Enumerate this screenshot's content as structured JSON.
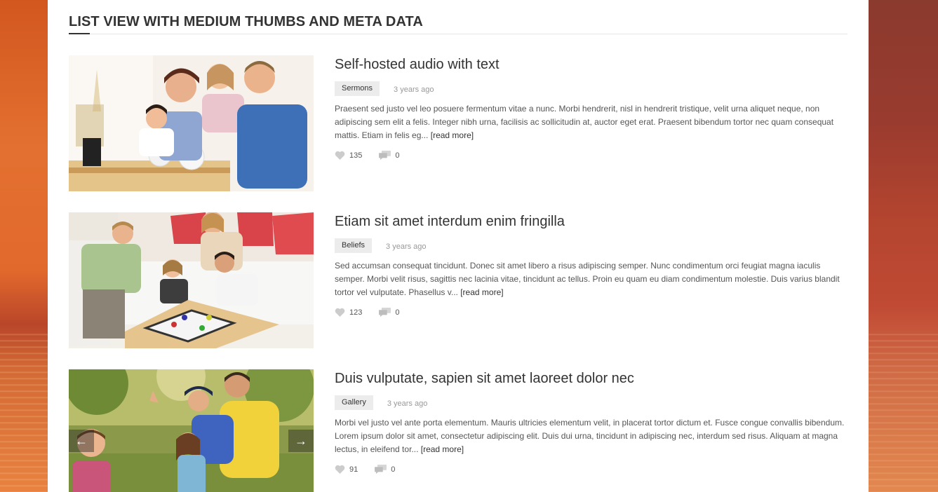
{
  "section": {
    "title": "LIST VIEW WITH MEDIUM THUMBS AND META DATA"
  },
  "posts": [
    {
      "title": "Self-hosted audio with text",
      "category": "Sermons",
      "date": "3 years ago",
      "excerpt": "Praesent sed justo vel leo posuere fermentum vitae a nunc. Morbi hendrerit, nisl in hendrerit tristique, velit urna aliquet neque, non adipiscing sem elit a felis. Integer nibh urna, facilisis ac sollicitudin at, auctor eget erat. Praesent bibendum tortor nec quam consequat mattis. Etiam in felis eg...",
      "read_more": "[read more]",
      "likes": "135",
      "comments": "0"
    },
    {
      "title": "Etiam sit amet interdum enim fringilla",
      "category": "Beliefs",
      "date": "3 years ago",
      "excerpt": "Sed accumsan consequat tincidunt. Donec sit amet libero a risus adipiscing semper. Nunc condimentum orci feugiat magna iaculis semper. Morbi velit risus, sagittis nec lacinia vitae, tincidunt ac tellus. Proin eu quam eu diam condimentum molestie. Duis varius blandit tortor vel vulputate. Phasellus v...",
      "read_more": "[read more]",
      "likes": "123",
      "comments": "0"
    },
    {
      "title": "Duis vulputate, sapien sit amet laoreet dolor nec",
      "category": "Gallery",
      "date": "3 years ago",
      "excerpt": "Morbi vel justo vel ante porta elementum. Mauris ultricies elementum velit, in placerat tortor dictum et. Fusce congue convallis bibendum. Lorem ipsum dolor sit amet, consectetur adipiscing elit. Duis dui urna, tincidunt in adipiscing nec, interdum sed risus. Aliquam at magna lectus, in eleifend tor...",
      "read_more": "[read more]",
      "likes": "91",
      "comments": "0"
    }
  ],
  "slider": {
    "prev_symbol": "←",
    "next_symbol": "→"
  },
  "icons": {
    "like": "heart-icon",
    "comment": "comment-bubbles-icon",
    "slider_prev": "arrow-left-icon",
    "slider_next": "arrow-right-icon"
  },
  "colors": {
    "heading": "#333333",
    "text": "#555555",
    "meta_gray": "#999999",
    "category_bg": "#ececec",
    "icon_gray": "#cccccc"
  }
}
